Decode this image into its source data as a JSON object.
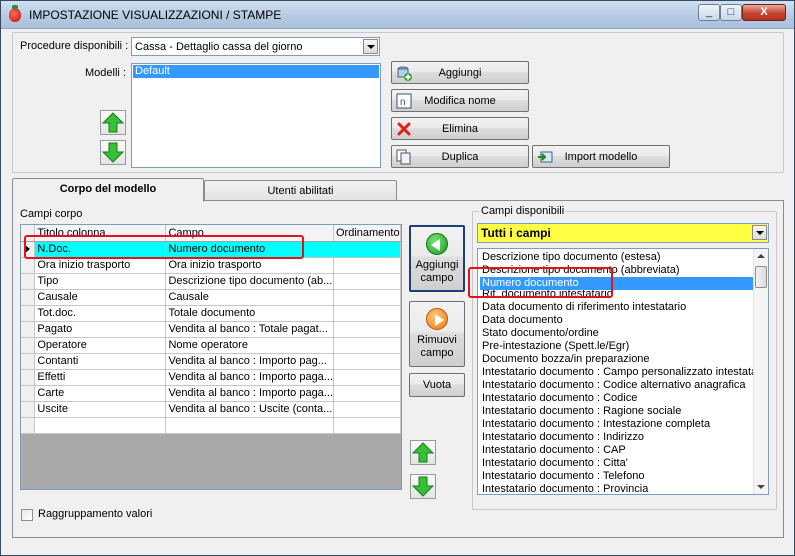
{
  "window": {
    "title": "IMPOSTAZIONE VISUALIZZAZIONI / STAMPE",
    "minimize_glyph": "_",
    "maximize_glyph": "□",
    "close_glyph": "X"
  },
  "procedures": {
    "label": "Procedure disponibili :",
    "selected": "Cassa - Dettaglio cassa del giorno"
  },
  "models": {
    "label": "Modelli :",
    "items": [
      "Default"
    ],
    "selected_index": 0
  },
  "model_buttons": {
    "add": "Aggiungi",
    "rename": "Modifica nome",
    "delete": "Elimina",
    "duplicate": "Duplica",
    "import": "Import modello"
  },
  "tabs": [
    {
      "label": "Corpo del modello",
      "active": true
    },
    {
      "label": "Utenti abilitati",
      "active": false
    }
  ],
  "body_fields": {
    "label": "Campi corpo",
    "columns": [
      "Titolo colonna",
      "Campo",
      "Ordinamento"
    ],
    "rows": [
      {
        "title": "N.Doc.",
        "field": "Numero documento",
        "order": ""
      },
      {
        "title": "Ora inizio trasporto",
        "field": "Ora inizio trasporto",
        "order": ""
      },
      {
        "title": "Tipo",
        "field": "Descrizione tipo documento (ab...",
        "order": ""
      },
      {
        "title": "Causale",
        "field": "Causale",
        "order": ""
      },
      {
        "title": "Tot.doc.",
        "field": "Totale documento",
        "order": ""
      },
      {
        "title": "Pagato",
        "field": "Vendita al banco : Totale pagat...",
        "order": ""
      },
      {
        "title": "Operatore",
        "field": "Nome operatore",
        "order": ""
      },
      {
        "title": "Contanti",
        "field": "Vendita al banco  : Importo pag...",
        "order": ""
      },
      {
        "title": "Effetti",
        "field": "Vendita al banco : Importo paga...",
        "order": ""
      },
      {
        "title": "Carte",
        "field": "Vendita al banco : Importo paga...",
        "order": ""
      },
      {
        "title": "Uscite",
        "field": "Vendita al banco : Uscite (conta...",
        "order": ""
      },
      {
        "title": "",
        "field": "",
        "order": ""
      }
    ],
    "selected_index": 0
  },
  "middle_buttons": {
    "add_field_line1": "Aggiungi",
    "add_field_line2": "campo",
    "remove_field_line1": "Rimuovi",
    "remove_field_line2": "campo",
    "empty": "Vuota"
  },
  "available_fields": {
    "label": "Campi disponibili",
    "filter": "Tutti i campi",
    "items": [
      "Descrizione tipo documento (estesa)",
      "Descrizione tipo documento (abbreviata)",
      "Numero documento",
      "Rif. documento intestatario",
      "Data documento di riferimento intestatario",
      "Data documento",
      "Stato documento/ordine",
      "Pre-intestazione (Spett.le/Egr)",
      "Documento bozza/in preparazione",
      "Intestatario documento : Campo personalizzato intestatario",
      "Intestatario documento : Codice alternativo anagrafica",
      "Intestatario documento : Codice",
      "Intestatario documento : Ragione sociale",
      "Intestatario documento : Intestazione completa",
      "Intestatario documento : Indirizzo",
      "Intestatario documento : CAP",
      "Intestatario documento : Citta'",
      "Intestatario documento : Telefono",
      "Intestatario documento : Provincia"
    ],
    "selected_index": 2
  },
  "grouping": {
    "label": "Raggruppamento valori",
    "checked": false
  },
  "colors": {
    "selection": "#3399ff",
    "grid_selected_row": "#00ffff",
    "filter_combo": "#ffff44",
    "highlight_box": "#e0141a"
  }
}
